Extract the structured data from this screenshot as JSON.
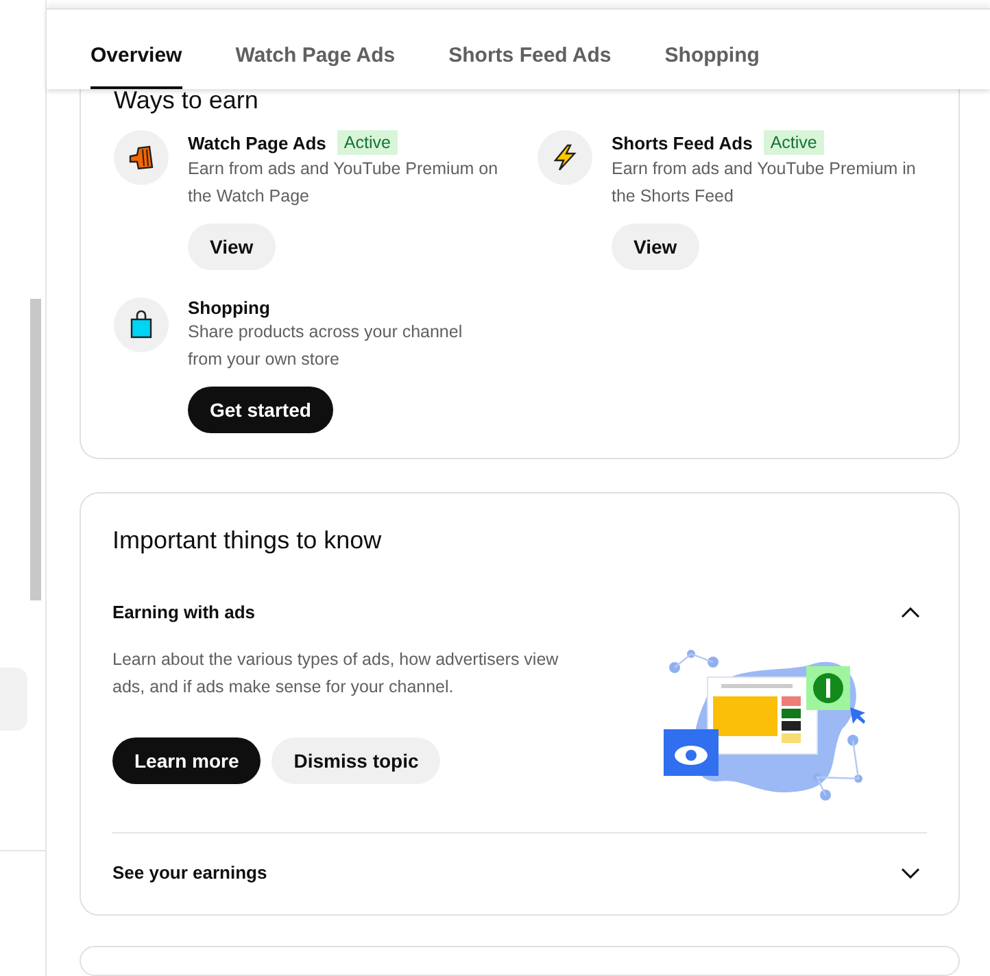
{
  "tabs": [
    {
      "label": "Overview",
      "selected": true
    },
    {
      "label": "Watch Page Ads",
      "selected": false
    },
    {
      "label": "Shorts Feed Ads",
      "selected": false
    },
    {
      "label": "Shopping",
      "selected": false
    }
  ],
  "ways_to_earn": {
    "title": "Ways to earn",
    "items": [
      {
        "name": "Watch Page Ads",
        "badge": "Active",
        "description": "Earn from ads and YouTube Premium on the Watch Page",
        "button": {
          "label": "View",
          "kind": "secondary"
        }
      },
      {
        "name": "Shorts Feed Ads",
        "badge": "Active",
        "description": "Earn from ads and YouTube Premium in the Shorts Feed",
        "button": {
          "label": "View",
          "kind": "secondary"
        }
      },
      {
        "name": "Shopping",
        "description": "Share products across your channel from your own store",
        "button": {
          "label": "Get started",
          "kind": "primary"
        }
      }
    ]
  },
  "important": {
    "title": "Important things to know",
    "topics": [
      {
        "title": "Earning with ads",
        "expanded": true,
        "description": "Learn about the various types of ads, how advertisers view ads, and if ads make sense for your channel.",
        "buttons": [
          {
            "label": "Learn more",
            "kind": "primary"
          },
          {
            "label": "Dismiss topic",
            "kind": "secondary"
          }
        ]
      },
      {
        "title": "See your earnings",
        "expanded": false
      }
    ]
  }
}
